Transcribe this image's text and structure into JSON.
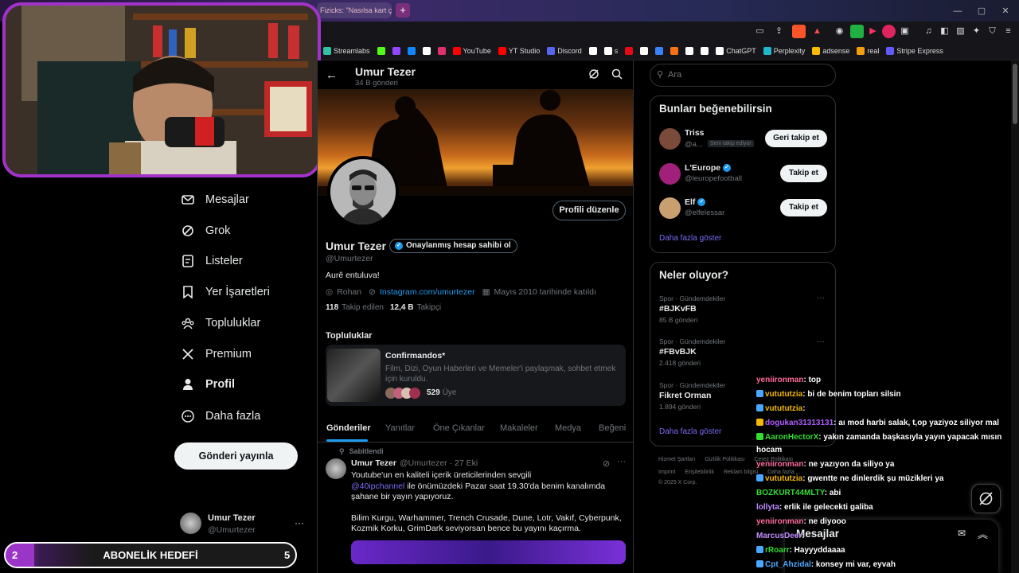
{
  "browser": {
    "active_tab_title": "Fizicks: \"Nasılsa kart çı",
    "new_tab_label": "+",
    "window_controls": [
      "—",
      "▢",
      "✕"
    ],
    "bookmarks": [
      {
        "label": "Streamlabs",
        "color": "#31c3a2"
      },
      {
        "label": "",
        "color": "#53fc18"
      },
      {
        "label": "",
        "color": "#9146ff"
      },
      {
        "label": "",
        "color": "#1185fe"
      },
      {
        "label": "",
        "color": "#ffffff"
      },
      {
        "label": "",
        "color": "#e1306c"
      },
      {
        "label": "YouTube",
        "color": "#ff0000"
      },
      {
        "label": "YT Studio",
        "color": "#ff0000"
      },
      {
        "label": "Discord",
        "color": "#5865f2"
      },
      {
        "label": "",
        "color": "#ffffff"
      },
      {
        "label": "s",
        "color": "#ffffff"
      },
      {
        "label": "",
        "color": "#e50914"
      },
      {
        "label": "",
        "color": "#ffffff"
      },
      {
        "label": "",
        "color": "#3b82f6"
      },
      {
        "label": "",
        "color": "#f97316"
      },
      {
        "label": "",
        "color": "#ffffff"
      },
      {
        "label": "",
        "color": "#ffffff"
      },
      {
        "label": "ChatGPT",
        "color": "#ffffff"
      },
      {
        "label": "Perplexity",
        "color": "#20b8cd"
      },
      {
        "label": "adsense",
        "color": "#fbbc04"
      },
      {
        "label": "real",
        "color": "#f59e0b"
      },
      {
        "label": "Stripe Express",
        "color": "#635bff"
      }
    ]
  },
  "nav": {
    "items": [
      {
        "label": "Mesajlar",
        "icon": "mail-icon"
      },
      {
        "label": "Grok",
        "icon": "grok-icon"
      },
      {
        "label": "Listeler",
        "icon": "list-icon"
      },
      {
        "label": "Yer İşaretleri",
        "icon": "bookmark-icon"
      },
      {
        "label": "Topluluklar",
        "icon": "communities-icon"
      },
      {
        "label": "Premium",
        "icon": "x-logo-icon"
      },
      {
        "label": "Profil",
        "icon": "person-icon"
      },
      {
        "label": "Daha fazla",
        "icon": "more-circle-icon"
      }
    ],
    "post_button": "Gönderi yayınla",
    "account": {
      "name": "Umur Tezer",
      "handle": "@Umurtezer",
      "more": "···"
    }
  },
  "profile": {
    "header_name": "Umur Tezer",
    "header_posts": "34 B gönderi",
    "edit_button": "Profili düzenle",
    "name": "Umur Tezer",
    "verified_label": "Onaylanmış hesap sahibi ol",
    "handle": "@Umurtezer",
    "bio": "Aurê entuluva!",
    "location": "Rohan",
    "website": "Instagram.com/umurtezer",
    "joined": "Mayıs 2010 tarihinde katıldı",
    "following_count": "118",
    "following_label": "Takip edilen",
    "followers_count": "12,4 B",
    "followers_label": "Takipçi",
    "communities_heading": "Topluluklar",
    "community": {
      "name": "Confirmandos*",
      "desc": "Film, Dizi, Oyun Haberleri ve Memeler'i paylaşmak, sohbet etmek için kuruldu.",
      "members_count": "529",
      "members_label": "Üye"
    },
    "tabs": [
      "Gönderiler",
      "Yanıtlar",
      "Öne Çıkanlar",
      "Makaleler",
      "Medya",
      "Beğeni"
    ],
    "pinned_label": "Sabitlendi",
    "post": {
      "author": "Umur Tezer",
      "handle_time": "@Umurtezer · 27 Eki",
      "line1": "Youtube'un en kaliteli içerik üreticilerinden sevgili",
      "mention": "@40ipchannel",
      "line2": " ile önümüzdeki Pazar saat 19.30'da benim kanalımda",
      "line3": "şahane bir yayın yapıyoruz.",
      "line4": "Bilim Kurgu, Warhammer, Trench Crusade, Dune, Lotr, Vakıf, Cyberpunk,",
      "line5": "Kozmik Korku, GrimDark seviyorsan bence bu yayını kaçırma."
    }
  },
  "right": {
    "search_placeholder": "Ara",
    "who_to_follow": {
      "title": "Bunları beğenebilirsin",
      "users": [
        {
          "name": "Triss",
          "handle": "@a...",
          "tag": "Seni takip ediyor",
          "button": "Geri takip et",
          "color": "#7a4a3a"
        },
        {
          "name": "L'Europe",
          "handle": "@leuropefootball",
          "tag": "",
          "button": "Takip et",
          "color": "#a0207a"
        },
        {
          "name": "Elf",
          "handle": "@elfelessar",
          "tag": "",
          "button": "Takip et",
          "color": "#c8a070"
        }
      ],
      "show_more": "Daha fazla göster"
    },
    "trends": {
      "title": "Neler oluyor?",
      "items": [
        {
          "context": "Spor · Gündemdekiler",
          "name": "#BJKvFB",
          "count": "85 B gönderi"
        },
        {
          "context": "Spor · Gündemdekiler",
          "name": "#FBvBJK",
          "count": "2.418 gönderi"
        },
        {
          "context": "Spor · Gündemdekiler",
          "name": "Fikret Orman",
          "count": "1.894 gönderi"
        }
      ],
      "show_more": "Daha fazla göster"
    },
    "footer_links": [
      "Hizmet Şartları",
      "Gizlilik Politikası",
      "Çerez Politikası",
      "Imprint",
      "Erişilebilirlik",
      "Reklam bilgisi",
      "Daha fazla ..."
    ],
    "copyright": "© 2025 X Corp.",
    "messages_drawer": "Mesajlar"
  },
  "chat": [
    {
      "user": "yeniironman",
      "color": "#ff6b9d",
      "text": ": top"
    },
    {
      "user": "vutututzia",
      "color": "#f5b800",
      "text": ": bi de benim topları silsin"
    },
    {
      "user": "vutututzia",
      "color": "#f5b800",
      "text": ":"
    },
    {
      "user": "dogukan31313131",
      "color": "#b05cff",
      "text": ": aı mod harbi salak, t,op yaziyoz siliyor mal"
    },
    {
      "user": "AaronHectorX",
      "color": "#33dd33",
      "text": ": yakın zamanda başkasıyla yayın yapacak mısın"
    },
    {
      "user": "",
      "color": "#ffffff",
      "text": "hocam"
    },
    {
      "user": "yeniironman",
      "color": "#ff6b9d",
      "text": ": ne yazıyon da siliyo ya"
    },
    {
      "user": "vutututzia",
      "color": "#f5b800",
      "text": ": gwentte ne dinlerdik şu müzikleri ya"
    },
    {
      "user": "BOZKURT44MLTY",
      "color": "#33dd33",
      "text": ": abi"
    },
    {
      "user": "lollyta",
      "color": "#c38bff",
      "text": ": erlik ile gelecekti galiba"
    },
    {
      "user": "yeniironman",
      "color": "#ff6b9d",
      "text": ": ne diyooo"
    },
    {
      "user": "MarcusDeer",
      "color": "#c38bff",
      "text": ":"
    },
    {
      "user": "rRoarr",
      "color": "#33dd33",
      "text": ": Hayyyddaaaa"
    },
    {
      "user": "Cpt_Ahzidal",
      "color": "#4aa8ff",
      "text": ": konsey mi var, eyvah"
    }
  ],
  "goal": {
    "start": "2",
    "title": "ABONELİK HEDEFİ",
    "end": "5",
    "progress": 0.1
  }
}
